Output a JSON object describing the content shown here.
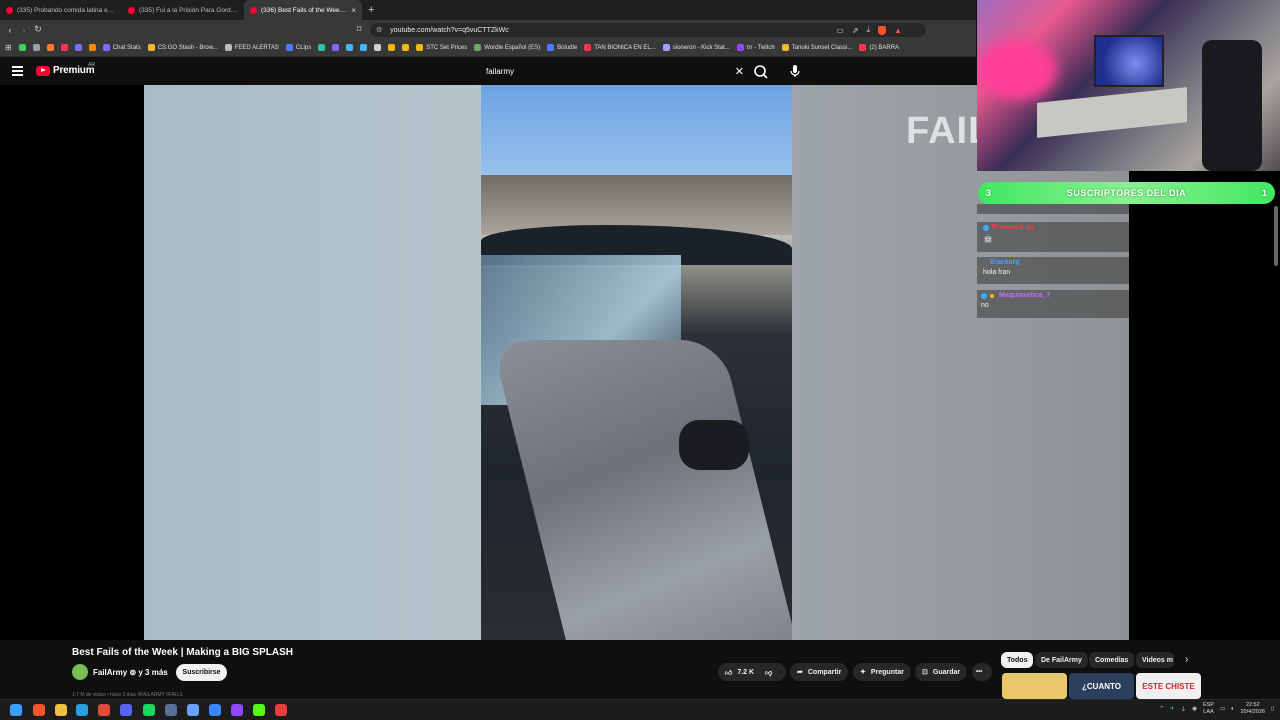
{
  "browser": {
    "tabs": [
      {
        "title": "(335) Probando comida latina en JAP"
      },
      {
        "title": "(335) Fui a la Prisión Para Gordos de"
      },
      {
        "title": "(336) Best Fails of the Week | M..."
      }
    ],
    "new_tab": "+",
    "close_glyph": "×",
    "url": "youtube.com/watch?v=q5vuCTTZkWc",
    "bookmarks": [
      {
        "label": "",
        "color": "#3ecf5a"
      },
      {
        "label": "",
        "color": "#9aa0a6"
      },
      {
        "label": "",
        "color": "#ff7a2a"
      },
      {
        "label": "",
        "color": "#ff3355"
      },
      {
        "label": "",
        "color": "#7a6cff"
      },
      {
        "label": "",
        "color": "#ff8a00"
      },
      {
        "label": "Chat Stats",
        "color": "#7a6cff"
      },
      {
        "label": "CS:GO Stash - Brow...",
        "color": "#f2b630"
      },
      {
        "label": "FEED ALERTAS",
        "color": "#bbbbbb"
      },
      {
        "label": "CLips",
        "color": "#4a78ff"
      },
      {
        "label": "",
        "color": "#2fc3a4"
      },
      {
        "label": "",
        "color": "#7a6cff"
      },
      {
        "label": "",
        "color": "#4ab3ff"
      },
      {
        "label": "",
        "color": "#4ab3ff"
      },
      {
        "label": "",
        "color": "#cfcfcf"
      },
      {
        "label": "",
        "color": "#f0b90b"
      },
      {
        "label": "",
        "color": "#f0b90b"
      },
      {
        "label": "STC Set Prices",
        "color": "#f0b90b"
      },
      {
        "label": "Wordle Español (ES)",
        "color": "#6aaa64"
      },
      {
        "label": "Boludle",
        "color": "#4a78ff"
      },
      {
        "label": "TAN BIONICA EN EL...",
        "color": "#ff3355"
      },
      {
        "label": "sioneron - Kick Stat...",
        "color": "#9aa0ff"
      },
      {
        "label": "trr - Twitch",
        "color": "#9146ff"
      },
      {
        "label": "Tanuki Sunset Classi...",
        "color": "#f2b630"
      },
      {
        "label": "(2) BARRA",
        "color": "#ff3355"
      }
    ]
  },
  "youtube": {
    "logo_text": "Premium",
    "country_code": "AR",
    "search_query": "failarmy",
    "video": {
      "overlay_text": "FAIL",
      "title": "Best Fails of the Week | Making a BIG SPLASH",
      "channel": "FailArmy ⊚ y 3 más",
      "subscribe_label": "Suscribirse",
      "likes": "7.2 K",
      "share_label": "Compartir",
      "ask_label": "Preguntar",
      "save_label": "Guardar",
      "more_label": "•••",
      "description_peek": "1.7 M de vistas • hace 3 días  #FAILARMY #FAILS"
    },
    "chips": [
      "Todos",
      "De FailArmy",
      "Comedias",
      "Videos m"
    ],
    "thumbnails": [
      {
        "text": "",
        "bg": "#e8c86a",
        "color": "#222"
      },
      {
        "text": "¿CUANTO",
        "bg": "#2c3f5c",
        "color": "#fff"
      },
      {
        "text": "ESTE CHISTE",
        "bg": "#f0f0f0",
        "color": "#d23"
      }
    ]
  },
  "stream_overlay": {
    "subs_left": "3",
    "subs_label": "SUSCRIPTORES DEL DIA",
    "subs_right": "1",
    "chat": [
      {
        "user": "",
        "message": "",
        "color": "#ccc"
      },
      {
        "user": "Francock_cs",
        "message": "🤖",
        "color": "#ff3b3b"
      },
      {
        "user": "Blackarg",
        "message": "hola fran",
        "color": "#4a9dff"
      },
      {
        "user": "Maquiavelica_7",
        "message": "no",
        "color": "#c86dff"
      }
    ]
  },
  "taskbar": {
    "lang": "ESP",
    "lang_sub": "LAA",
    "time": "22:52",
    "date": "20/4/2026",
    "icons": [
      {
        "name": "windows-start",
        "color": "#3aa0ff"
      },
      {
        "name": "brave-browser",
        "color": "#fb542b"
      },
      {
        "name": "file-explorer",
        "color": "#f0c040"
      },
      {
        "name": "telegram",
        "color": "#2aa0e0"
      },
      {
        "name": "chrome",
        "color": "#e24a3a"
      },
      {
        "name": "discord",
        "color": "#5865f2"
      },
      {
        "name": "spotify",
        "color": "#1ed760"
      },
      {
        "name": "steam",
        "color": "#5a6f9a"
      },
      {
        "name": "network",
        "color": "#6aa0ff"
      },
      {
        "name": "app-blue",
        "color": "#3a86ff"
      },
      {
        "name": "twitch",
        "color": "#9146ff"
      },
      {
        "name": "kick",
        "color": "#53fc18"
      },
      {
        "name": "recorder",
        "color": "#e84040"
      }
    ]
  }
}
